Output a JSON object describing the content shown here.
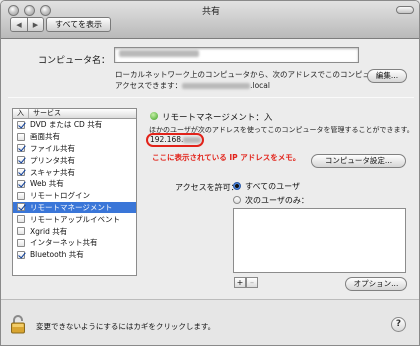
{
  "window": {
    "title": "共有"
  },
  "toolbar": {
    "back_label": "◀",
    "forward_label": "▶",
    "show_all_label": "すべてを表示"
  },
  "computer_name": {
    "label": "コンピュータ名：",
    "value": ""
  },
  "network": {
    "line1": "ローカルネットワーク上のコンピュータから、次のアドレスでこのコンピュータに",
    "line2_prefix": "アクセスできます：",
    "line2_suffix": ".local",
    "edit_label": "編集..."
  },
  "services": {
    "header_on": "入",
    "header_service": "サービス",
    "items": [
      {
        "label": "DVD または CD 共有",
        "checked": true,
        "selected": false
      },
      {
        "label": "画面共有",
        "checked": false,
        "selected": false
      },
      {
        "label": "ファイル共有",
        "checked": true,
        "selected": false
      },
      {
        "label": "プリンタ共有",
        "checked": true,
        "selected": false
      },
      {
        "label": "スキャナ共有",
        "checked": true,
        "selected": false
      },
      {
        "label": "Web 共有",
        "checked": true,
        "selected": false
      },
      {
        "label": "リモートログイン",
        "checked": false,
        "selected": false
      },
      {
        "label": "リモートマネージメント",
        "checked": true,
        "selected": true
      },
      {
        "label": "リモートアップルイベント",
        "checked": false,
        "selected": false
      },
      {
        "label": "Xgrid 共有",
        "checked": false,
        "selected": false
      },
      {
        "label": "インターネット共有",
        "checked": false,
        "selected": false
      },
      {
        "label": "Bluetooth 共有",
        "checked": true,
        "selected": false
      }
    ]
  },
  "detail": {
    "status": "リモートマネージメント：入",
    "description": "ほかのユーザが次のアドレスを使ってこのコンピュータを管理することができます。",
    "ip_prefix": "192.168.",
    "annotation": "ここに表示されている IP アドレスをメモ。",
    "computer_settings_label": "コンピュータ設定..."
  },
  "access": {
    "label": "アクセスを許可：",
    "option_all": "すべてのユーザ",
    "option_only": "次のユーザのみ：",
    "plus": "+",
    "minus": "–",
    "options_label": "オプション..."
  },
  "footer": {
    "lock_text": "変更できないようにするにはカギをクリックします。",
    "help_label": "?"
  },
  "colors": {
    "accent": "#3a76d8",
    "annotation": "#e2231a",
    "status_on": "#3aa021"
  }
}
